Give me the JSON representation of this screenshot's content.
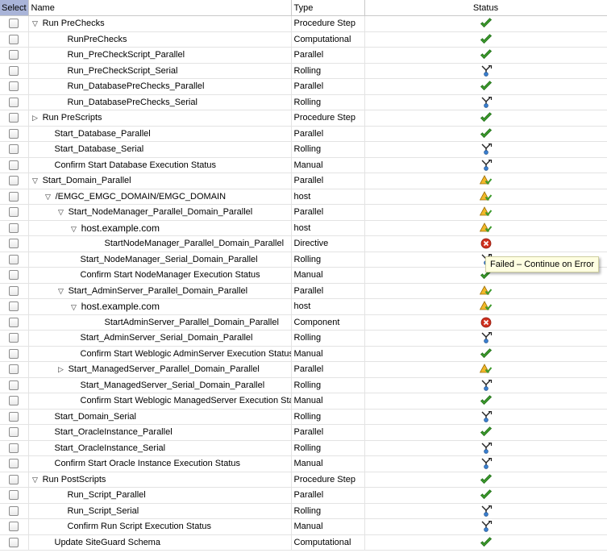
{
  "columns": {
    "select": "Select",
    "name": "Name",
    "type": "Type",
    "status": "Status"
  },
  "tooltip": "Failed – Continue on Error",
  "rows": [
    {
      "name": "Run PreChecks",
      "type": "Procedure Step",
      "status": "success",
      "indent": 0,
      "toggle": "▽"
    },
    {
      "name": "RunPreChecks",
      "type": "Computational",
      "status": "success",
      "indent": 2
    },
    {
      "name": "Run_PreCheckScript_Parallel",
      "type": "Parallel",
      "status": "success",
      "indent": 2
    },
    {
      "name": "Run_PreCheckScript_Serial",
      "type": "Rolling",
      "status": "rolling",
      "indent": 2
    },
    {
      "name": "Run_DatabasePreChecks_Parallel",
      "type": "Parallel",
      "status": "success",
      "indent": 2
    },
    {
      "name": "Run_DatabasePreChecks_Serial",
      "type": "Rolling",
      "status": "rolling",
      "indent": 2
    },
    {
      "name": "Run PreScripts",
      "type": "Procedure Step",
      "status": "success",
      "indent": 0,
      "toggle": "▷"
    },
    {
      "name": "Start_Database_Parallel",
      "type": "Parallel",
      "status": "success",
      "indent": 1
    },
    {
      "name": "Start_Database_Serial",
      "type": "Rolling",
      "status": "rolling",
      "indent": 1
    },
    {
      "name": "Confirm Start Database Execution Status",
      "type": "Manual",
      "status": "rolling",
      "indent": 1
    },
    {
      "name": "Start_Domain_Parallel",
      "type": "Parallel",
      "status": "warning",
      "indent": 0,
      "toggle": "▽"
    },
    {
      "name": "/EMGC_EMGC_DOMAIN/EMGC_DOMAIN",
      "type": "host",
      "status": "warning",
      "indent": 1,
      "toggle": "▽"
    },
    {
      "name": "Start_NodeManager_Parallel_Domain_Parallel",
      "type": "Parallel",
      "status": "warning",
      "indent": 2,
      "toggle": "▽"
    },
    {
      "name": "host.example.com",
      "type": "host",
      "status": "warning",
      "indent": 3,
      "toggle": "▽",
      "big": true
    },
    {
      "name": "StartNodeManager_Parallel_Domain_Parallel",
      "type": "Directive",
      "status": "failed",
      "indent": 4
    },
    {
      "name": "Start_NodeManager_Serial_Domain_Parallel",
      "type": "Rolling",
      "status": "rolling",
      "indent": 3
    },
    {
      "name": "Confirm Start NodeManager Execution Status",
      "type": "Manual",
      "status": "success",
      "indent": 3
    },
    {
      "name": "Start_AdminServer_Parallel_Domain_Parallel",
      "type": "Parallel",
      "status": "warning",
      "indent": 2,
      "toggle": "▽"
    },
    {
      "name": "host.example.com",
      "type": "host",
      "status": "warning",
      "indent": 3,
      "toggle": "▽",
      "big": true
    },
    {
      "name": "StartAdminServer_Parallel_Domain_Parallel",
      "type": "Component",
      "status": "failed",
      "indent": 4
    },
    {
      "name": "Start_AdminServer_Serial_Domain_Parallel",
      "type": "Rolling",
      "status": "rolling",
      "indent": 3
    },
    {
      "name": "Confirm Start Weblogic AdminServer Execution Status",
      "type": "Manual",
      "status": "success",
      "indent": 3
    },
    {
      "name": "Start_ManagedServer_Parallel_Domain_Parallel",
      "type": "Parallel",
      "status": "warning",
      "indent": 2,
      "toggle": "▷"
    },
    {
      "name": "Start_ManagedServer_Serial_Domain_Parallel",
      "type": "Rolling",
      "status": "rolling",
      "indent": 3
    },
    {
      "name": "Confirm Start Weblogic ManagedServer Execution Status",
      "type": "Manual",
      "status": "success",
      "indent": 3
    },
    {
      "name": "Start_Domain_Serial",
      "type": "Rolling",
      "status": "rolling",
      "indent": 1
    },
    {
      "name": "Start_OracleInstance_Parallel",
      "type": "Parallel",
      "status": "success",
      "indent": 1
    },
    {
      "name": "Start_OracleInstance_Serial",
      "type": "Rolling",
      "status": "rolling",
      "indent": 1
    },
    {
      "name": "Confirm Start Oracle Instance Execution Status",
      "type": "Manual",
      "status": "rolling",
      "indent": 1
    },
    {
      "name": "Run PostScripts",
      "type": "Procedure Step",
      "status": "success",
      "indent": 0,
      "toggle": "▽"
    },
    {
      "name": "Run_Script_Parallel",
      "type": "Parallel",
      "status": "success",
      "indent": 2
    },
    {
      "name": "Run_Script_Serial",
      "type": "Rolling",
      "status": "rolling",
      "indent": 2
    },
    {
      "name": "Confirm Run Script Execution Status",
      "type": "Manual",
      "status": "rolling",
      "indent": 2
    },
    {
      "name": "Update SiteGuard Schema",
      "type": "Computational",
      "status": "success",
      "indent": 1
    }
  ]
}
